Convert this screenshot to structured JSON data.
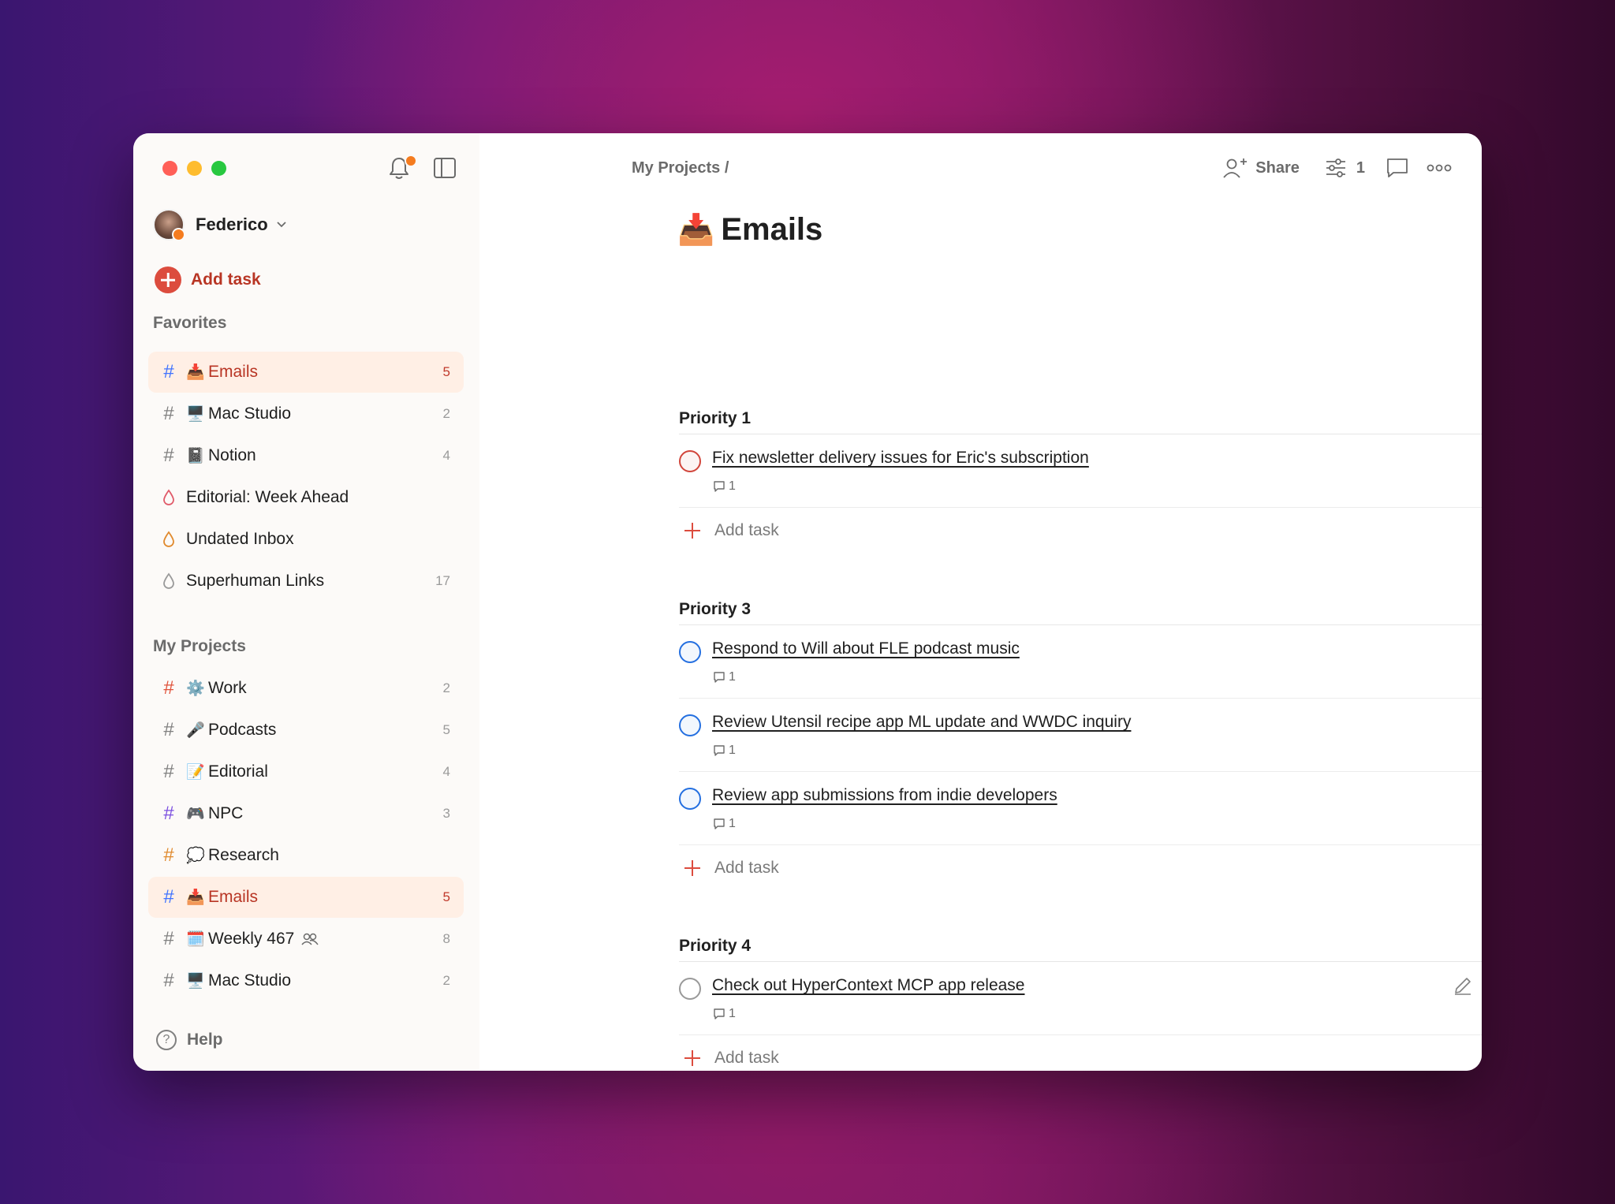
{
  "window": {
    "breadcrumb": "My Projects /"
  },
  "sidebar": {
    "user": {
      "name": "Federico"
    },
    "add_task_label": "Add task",
    "favorites_title": "Favorites",
    "favorites": [
      {
        "icon": "hash",
        "emoji": "📥",
        "label": "Emails",
        "count": "5",
        "active": true
      },
      {
        "icon": "hash",
        "emoji": "🖥️",
        "label": "Mac Studio",
        "count": "2"
      },
      {
        "icon": "hash",
        "emoji": "📓",
        "label": "Notion",
        "count": "4"
      },
      {
        "icon": "drop-red",
        "emoji": "",
        "label": "Editorial: Week Ahead",
        "count": ""
      },
      {
        "icon": "drop-orange",
        "emoji": "",
        "label": "Undated Inbox",
        "count": ""
      },
      {
        "icon": "drop-gray",
        "emoji": "",
        "label": "Superhuman Links",
        "count": "17"
      }
    ],
    "projects_title": "My Projects",
    "projects": [
      {
        "icon": "hash",
        "emoji": "⚙️",
        "label": "Work",
        "count": "2"
      },
      {
        "icon": "hash",
        "emoji": "🎤",
        "label": "Podcasts",
        "count": "5"
      },
      {
        "icon": "hash",
        "emoji": "📝",
        "label": "Editorial",
        "count": "4"
      },
      {
        "icon": "hash",
        "emoji": "🎮",
        "label": "NPC",
        "count": "3"
      },
      {
        "icon": "hash",
        "emoji": "💭",
        "label": "Research",
        "count": ""
      },
      {
        "icon": "hash",
        "emoji": "📥",
        "label": "Emails",
        "count": "5",
        "active": true
      },
      {
        "icon": "hash",
        "emoji": "🗓️",
        "label": "Weekly 467",
        "count": "8",
        "shared": true
      },
      {
        "icon": "hash",
        "emoji": "🖥️",
        "label": "Mac Studio",
        "count": "2"
      }
    ],
    "help_label": "Help"
  },
  "toolbar": {
    "share_label": "Share",
    "filter_count": "1"
  },
  "page": {
    "emoji": "📥",
    "title": "Emails",
    "groups": [
      {
        "header": "Priority 1",
        "tasks": [
          {
            "priority": "p1",
            "title": "Fix newsletter delivery issues for Eric's subscription",
            "comments": "1"
          }
        ],
        "add_label": "Add task"
      },
      {
        "header": "Priority 3",
        "tasks": [
          {
            "priority": "p3",
            "title": "Respond to Will about FLE podcast music",
            "comments": "1"
          },
          {
            "priority": "p3",
            "title": "Review Utensil recipe app ML update and WWDC inquiry",
            "comments": "1"
          },
          {
            "priority": "p3",
            "title": "Review app submissions from indie developers",
            "comments": "1"
          }
        ],
        "add_label": "Add task"
      },
      {
        "header": "Priority 4",
        "tasks": [
          {
            "priority": "p4",
            "title": "Check out HyperContext MCP app release",
            "comments": "1",
            "hovered": true
          }
        ],
        "add_label": "Add task"
      }
    ]
  },
  "colors": {
    "accent": "#dc4c3e",
    "active_bg": "#ffefe5",
    "p1": "#d1453b",
    "p3": "#246fe0",
    "drop_red": "#e05a69",
    "drop_orange": "#e08a2e",
    "drop_gray": "#9a9a9a",
    "hash_blue": "#4073ff",
    "hash_red": "#e0533b",
    "hash_purple": "#7b4fe0",
    "hash_orange": "#e08a2e"
  }
}
